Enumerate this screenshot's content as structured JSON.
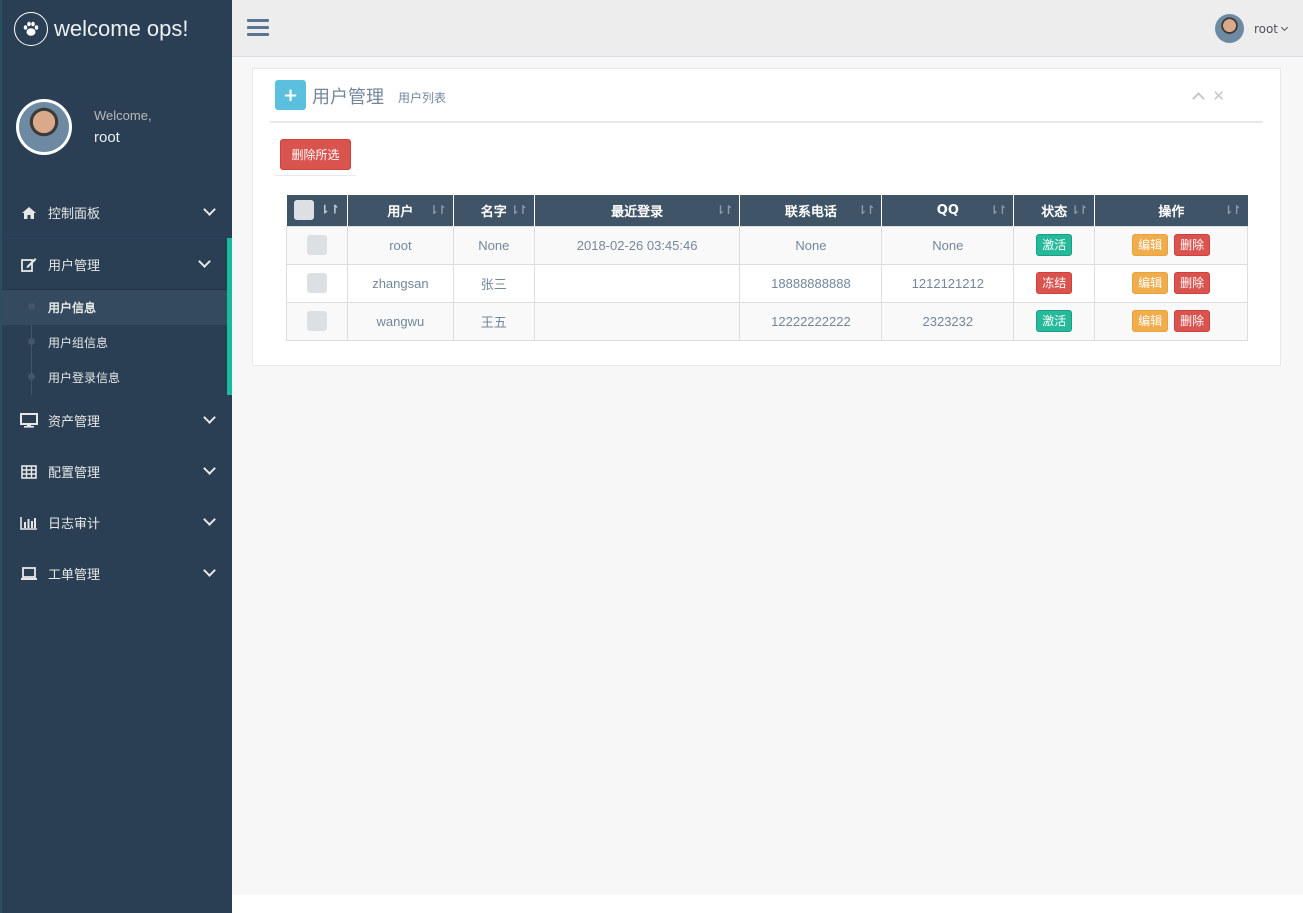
{
  "brand": {
    "name": "welcome ops!",
    "logo_icon": "paw-icon"
  },
  "profile": {
    "welcome": "Welcome,",
    "user": "root"
  },
  "sidebar": {
    "items": [
      {
        "label": "控制面板",
        "icon": "home-icon"
      },
      {
        "label": "用户管理",
        "icon": "edit-icon",
        "expanded": true,
        "children": [
          "用户信息",
          "用户组信息",
          "用户登录信息"
        ],
        "active_child": "用户信息"
      },
      {
        "label": "资产管理",
        "icon": "desktop-icon"
      },
      {
        "label": "配置管理",
        "icon": "table-icon"
      },
      {
        "label": "日志审计",
        "icon": "bar-chart-icon"
      },
      {
        "label": "工单管理",
        "icon": "laptop-icon"
      }
    ]
  },
  "topnav": {
    "user": "root"
  },
  "panel": {
    "title": "用户管理",
    "subtitle": "用户列表",
    "delete_selected": "删除所选"
  },
  "table": {
    "headers": [
      "用户",
      "名字",
      "最近登录",
      "联系电话",
      "QQ",
      "状态",
      "操作"
    ],
    "rows": [
      {
        "user": "root",
        "name": "None",
        "last_login": "2018-02-26 03:45:46",
        "phone": "None",
        "qq": "None",
        "status": "激活",
        "status_color": "#26B99A"
      },
      {
        "user": "zhangsan",
        "name": "张三",
        "last_login": "",
        "phone": "18888888888",
        "qq": "1212121212",
        "status": "冻结",
        "status_color": "#D9534F"
      },
      {
        "user": "wangwu",
        "name": "王五",
        "last_login": "",
        "phone": "12222222222",
        "qq": "2323232",
        "status": "激活",
        "status_color": "#26B99A"
      }
    ],
    "actions": {
      "edit": "编辑",
      "delete": "删除"
    }
  },
  "colors": {
    "sidebar": "#2A3F54",
    "accent": "#1ABB9C",
    "table_header": "#405467"
  }
}
